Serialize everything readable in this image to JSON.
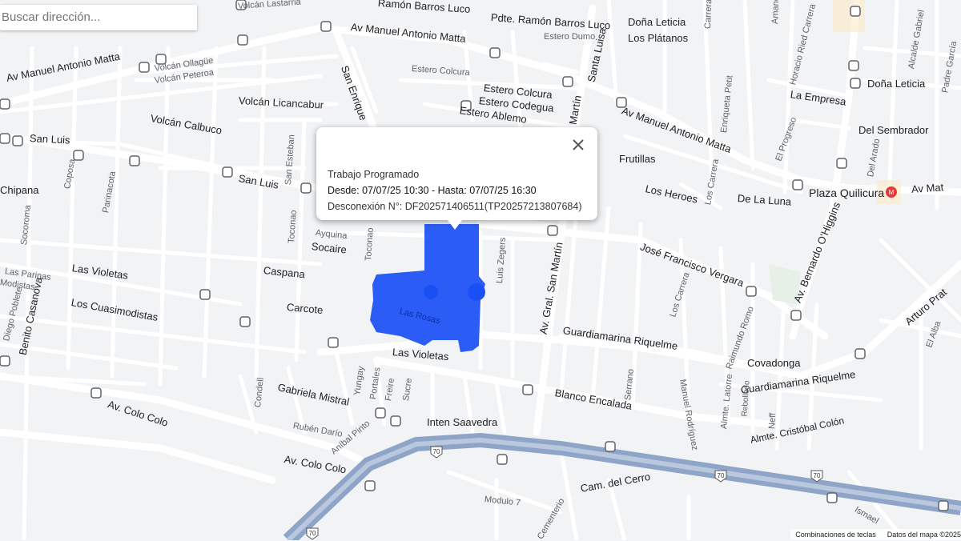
{
  "search": {
    "placeholder": "Buscar dirección..."
  },
  "popup": {
    "title": "Trabajo Programado",
    "range": "Desde: 07/07/25 10:30 - Hasta: 07/07/25 16:30",
    "disconnection": "Desconexión N°: DF202571406511(TP20257213807684)"
  },
  "footer": {
    "shortcuts": "Combinaciones de teclas",
    "map_data": "Datos del mapa ©2025"
  },
  "highway_shields": [
    "70",
    "70",
    "70",
    "70"
  ],
  "colors": {
    "outage_area": "#1a4ff5",
    "highway": "#8ea5c7",
    "background": "#f1f3f5"
  },
  "streets": {
    "manuel_antonio_matta_1": "Av Manuel Antonio Matta",
    "manuel_antonio_matta_2": "Av Manuel Antonio Matta",
    "manuel_antonio_matta_3": "Av Manuel Antonio Matta",
    "ramon_barros_luco_1": "Ramón Barros Luco",
    "ramon_barros_luco_2": "Pdte. Ramón Barros Luco",
    "volcan_lastarria": "Volcán Lastarria",
    "volcan_ollague": "Volcán Ollagüe",
    "volcan_peteroa": "Volcán Peteroa",
    "volcan_licancabur": "Volcán Licancabur",
    "volcan_calbuco": "Volcán Calbuco",
    "san_luis_1": "San Luis",
    "san_luis_2": "San Luis",
    "san_enrique": "San Enrique",
    "estero_dumo": "Estero Dumo",
    "estero_colcura_1": "Estero Colcura",
    "estero_colcura_2": "Estero Colcura",
    "estero_codegua": "Estero Codegua",
    "estero_ablemo": "Estero Ablemo",
    "santa_luisa": "Santa Luisa",
    "dona_leticia_1": "Doña Leticia",
    "dona_leticia_2": "Doña Leticia",
    "los_platanos": "Los Plátanos",
    "martin": "Martín",
    "frutillas": "Frutillas",
    "los_heroes": "Los Heroes",
    "de_la_luna": "De La Luna",
    "plaza_quilicura": "Plaza Quilicura",
    "av_mat": "Av Mat",
    "enriqueta_petit": "Enriqueta Petit",
    "horacio_ried": "Horacio Ried Carrera",
    "la_empresa": "La Empresa",
    "del_sembrador": "Del Sembrador",
    "el_progreso": "El Progreso",
    "del_arado": "Del Arado",
    "alcalde_gabriel": "Alcalde Gabriel",
    "padre_garcia": "Padre García",
    "los_carrera_1": "Los Carrera",
    "los_carrera_2": "Los Carrera",
    "chipana": "Chipana",
    "coposa": "Coposa",
    "parinacota": "Parinacota",
    "socoroma": "Socoroma",
    "san_esteban": "San Esteban",
    "toconao_1": "Toconao",
    "toconao_2": "Toconao",
    "ayquina": "Ayquina",
    "socaire": "Socaire",
    "caspana": "Caspana",
    "carcote": "Carcote",
    "las_violetas_1": "Las Violetas",
    "las_violetas_2": "Las Violetas",
    "las_parinas": "Las Parinas",
    "modistas": "Modistas",
    "los_cuasimodistas": "Los Cuasimodistas",
    "diego_poblete": "Diego Poblete",
    "benito_casanova": "Benito Casanova",
    "las_rosas": "Las Rosas",
    "luis_zegers": "Luis Zegers",
    "av_gral_san_martin": "Av. Gral. San Martín",
    "jose_francisco_vergara": "José Francisco Vergara",
    "guardiamarina_riquelme_1": "Guardiamarina Riquelme",
    "guardiamarina_riquelme_2": "Guardiamarina Riquelme",
    "av_bernardo_ohiggins": "Av. Bernardo O'Higgins",
    "arturo_prat": "Arturo Prat",
    "el_alba": "El Alba",
    "raimundo_romo": "Raimundo Romo",
    "covadonga": "Covadonga",
    "blanco_encalada": "Blanco Encalada",
    "serrano": "Serrano",
    "manuel_rodriguez": "Manuel Rodríguez",
    "almte_latorre": "Almte. Latorre",
    "rebolledo": "Rebolledo",
    "neff": "Neff",
    "almte_cristobal_colon": "Almte. Cristóbal Colón",
    "gabriela_mistral": "Gabriela Mistral",
    "condell": "Condell",
    "yungay": "Yungay",
    "portales": "Portales",
    "freire": "Freire",
    "sucre": "Sucre",
    "av_colo_colo_1": "Av. Colo Colo",
    "av_colo_colo_2": "Av. Colo Colo",
    "ruben_dario": "Rubén Darío",
    "anibal_pinto": "Aníbal Pinto",
    "inten_saavedra": "Inten Saavedra",
    "cam_del_cerro": "Cam. del Cerro",
    "modulo_7": "Modulo 7",
    "cementerio": "Cementerio",
    "ismael": "Ismael",
    "amanc": "Amanc",
    "carrera_top": "Carrera"
  }
}
